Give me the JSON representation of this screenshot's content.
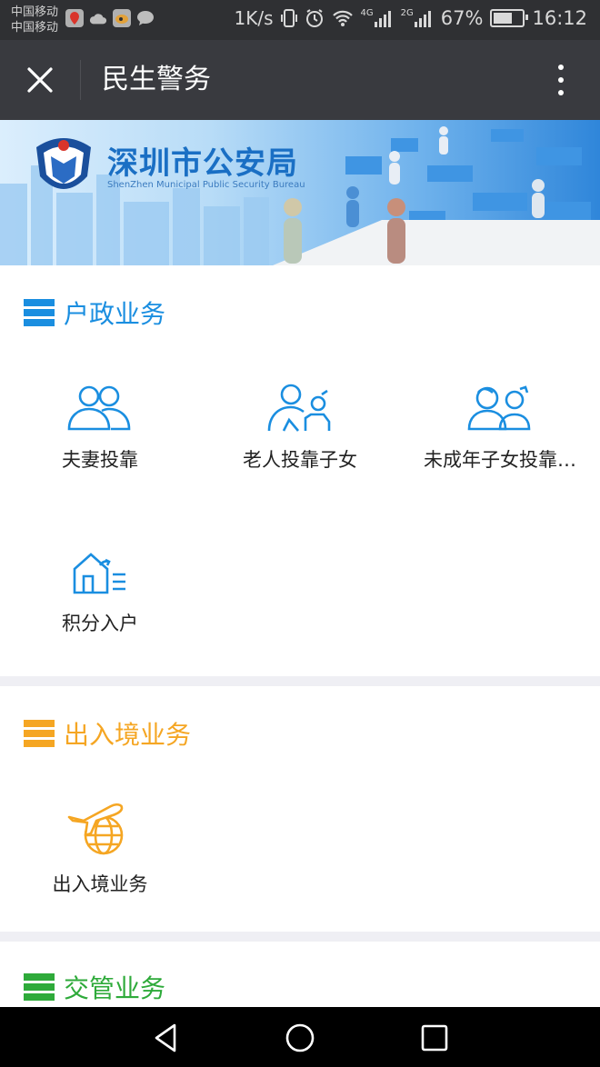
{
  "status_bar": {
    "carrier_1": "中国移动",
    "carrier_2": "中国移动",
    "speed": "1K/s",
    "network_4g": "4G",
    "network_2g": "2G",
    "battery": "67%",
    "time": "16:12"
  },
  "nav": {
    "title": "民生警务",
    "close_icon": "close-icon",
    "more_icon": "more-vertical-icon"
  },
  "banner": {
    "title": "深圳市公安局",
    "subtitle": "ShenZhen Municipal Public Security Bureau"
  },
  "sections": [
    {
      "title": "户政业务",
      "color": "#1a8ee0",
      "items": [
        {
          "label": "夫妻投靠",
          "icon": "couple-icon"
        },
        {
          "label": "老人投靠子女",
          "icon": "elderly-icon"
        },
        {
          "label": "未成年子女投靠…",
          "icon": "children-icon"
        },
        {
          "label": "积分入户",
          "icon": "house-points-icon"
        }
      ]
    },
    {
      "title": "出入境业务",
      "color": "#f5a623",
      "items": [
        {
          "label": "出入境业务",
          "icon": "airplane-globe-icon"
        }
      ]
    },
    {
      "title": "交管业务",
      "color": "#2eaa3a",
      "items": []
    }
  ]
}
